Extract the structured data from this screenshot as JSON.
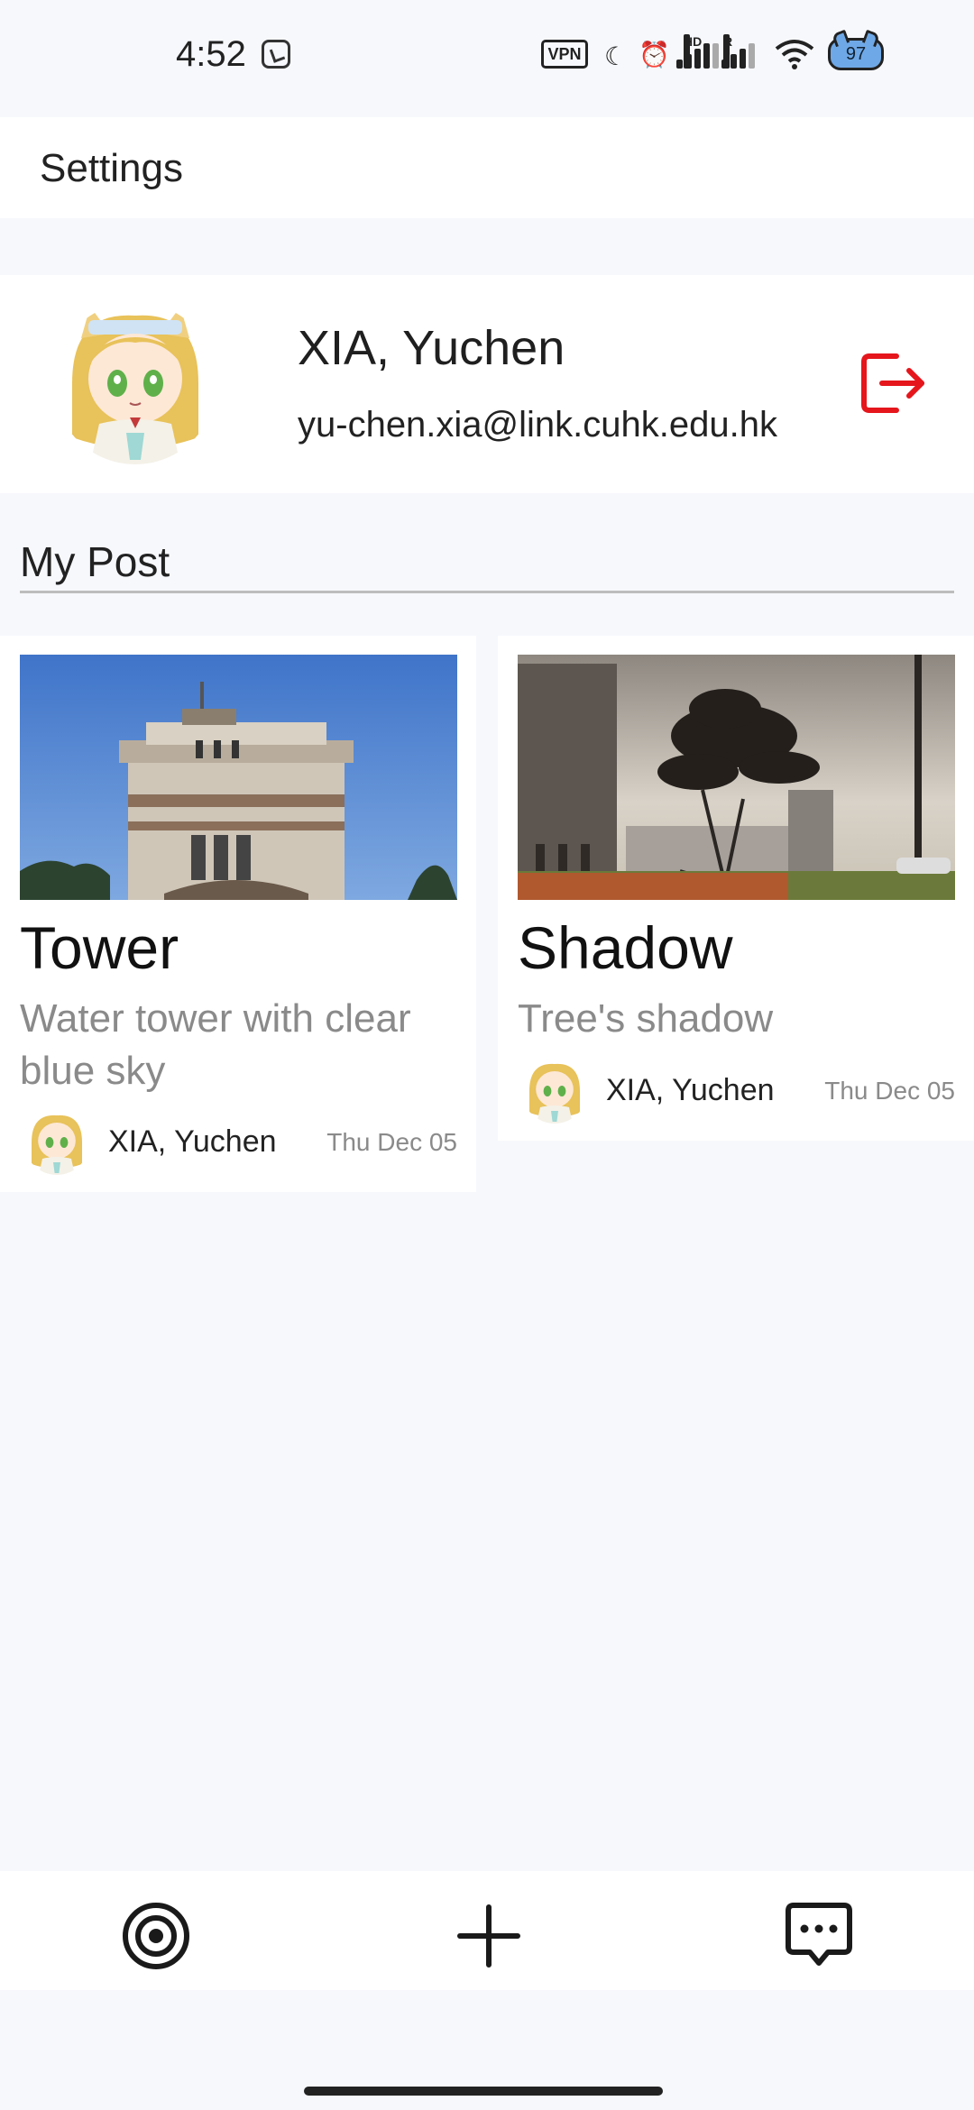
{
  "status_bar": {
    "time": "4:52",
    "vpn_label": "VPN",
    "signal1_label": "HD",
    "signal2_label": "R",
    "battery_level": "97",
    "icons": [
      "clock-app-icon",
      "moon-icon",
      "alarm-icon",
      "signal-icon",
      "wifi-icon",
      "battery-icon"
    ]
  },
  "header": {
    "title": "Settings"
  },
  "profile": {
    "name": "XIA, Yuchen",
    "email": "yu-chen.xia@link.cuhk.edu.hk",
    "logout_icon": "logout-icon",
    "logout_color": "#e5161c"
  },
  "section": {
    "title": "My Post"
  },
  "posts": [
    {
      "title": "Tower",
      "description": "Water tower with clear blue sky",
      "author": "XIA, Yuchen",
      "date": "Thu Dec 05"
    },
    {
      "title": "Shadow",
      "description": "Tree's shadow",
      "author": "XIA, Yuchen",
      "date": "Thu Dec 05"
    }
  ],
  "bottom_nav": {
    "items": [
      {
        "icon": "target-icon"
      },
      {
        "icon": "plus-icon"
      },
      {
        "icon": "chat-icon"
      }
    ]
  }
}
